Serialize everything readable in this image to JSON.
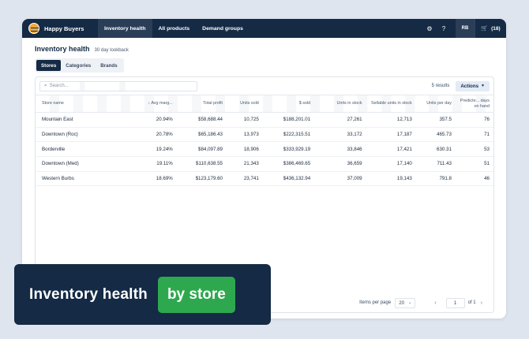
{
  "nav": {
    "brand": "Happy Buyers",
    "items": [
      {
        "label": "Inventory health",
        "active": true
      },
      {
        "label": "All products",
        "active": false
      },
      {
        "label": "Demand groups",
        "active": false
      }
    ],
    "settings_icon": "⚙",
    "help_icon": "?",
    "avatar": "RB",
    "cart_icon": "🛒",
    "cart_count": "(18)"
  },
  "page": {
    "title": "Inventory health",
    "subtitle": "30 day lookback"
  },
  "tabs": [
    {
      "label": "Stores",
      "active": true
    },
    {
      "label": "Categories",
      "active": false
    },
    {
      "label": "Brands",
      "active": false
    }
  ],
  "toolbar": {
    "search_placeholder": "Search...",
    "results": "5 results",
    "actions_label": "Actions"
  },
  "table": {
    "columns": [
      "Store name",
      "Avg marg...",
      "Total profit",
      "Units sold",
      "$ sold",
      "Units in stock",
      "Sellable units in stock",
      "Units per day",
      "Predicte... days on hand"
    ],
    "rows": [
      [
        "Mountain East",
        "20.94%",
        "$58,688.44",
        "10,725",
        "$188,201.01",
        "27,261",
        "12,713",
        "357.5",
        "76"
      ],
      [
        "Downtown (Roc)",
        "20.78%",
        "$65,186.43",
        "13,973",
        "$222,315.51",
        "33,172",
        "17,187",
        "465.73",
        "71"
      ],
      [
        "Borderville",
        "19.24%",
        "$84,097.89",
        "18,906",
        "$333,929.19",
        "33,846",
        "17,421",
        "630.31",
        "53"
      ],
      [
        "Downtown (Med)",
        "19.11%",
        "$110,638.55",
        "21,343",
        "$386,469.65",
        "36,659",
        "17,140",
        "711.43",
        "51"
      ],
      [
        "Western Burbs",
        "18.69%",
        "$123,179.60",
        "23,741",
        "$436,132.94",
        "37,009",
        "19,143",
        "791.8",
        "46"
      ]
    ]
  },
  "footer": {
    "items_per_page_label": "Items per page",
    "items_per_page": "20",
    "page": "1",
    "of_pages": "of 1"
  },
  "banner": {
    "text": "Inventory health",
    "pill": "by store"
  },
  "colors": {
    "navy": "#142a45",
    "green": "#2ea84f",
    "background": "#dfe5ef"
  }
}
